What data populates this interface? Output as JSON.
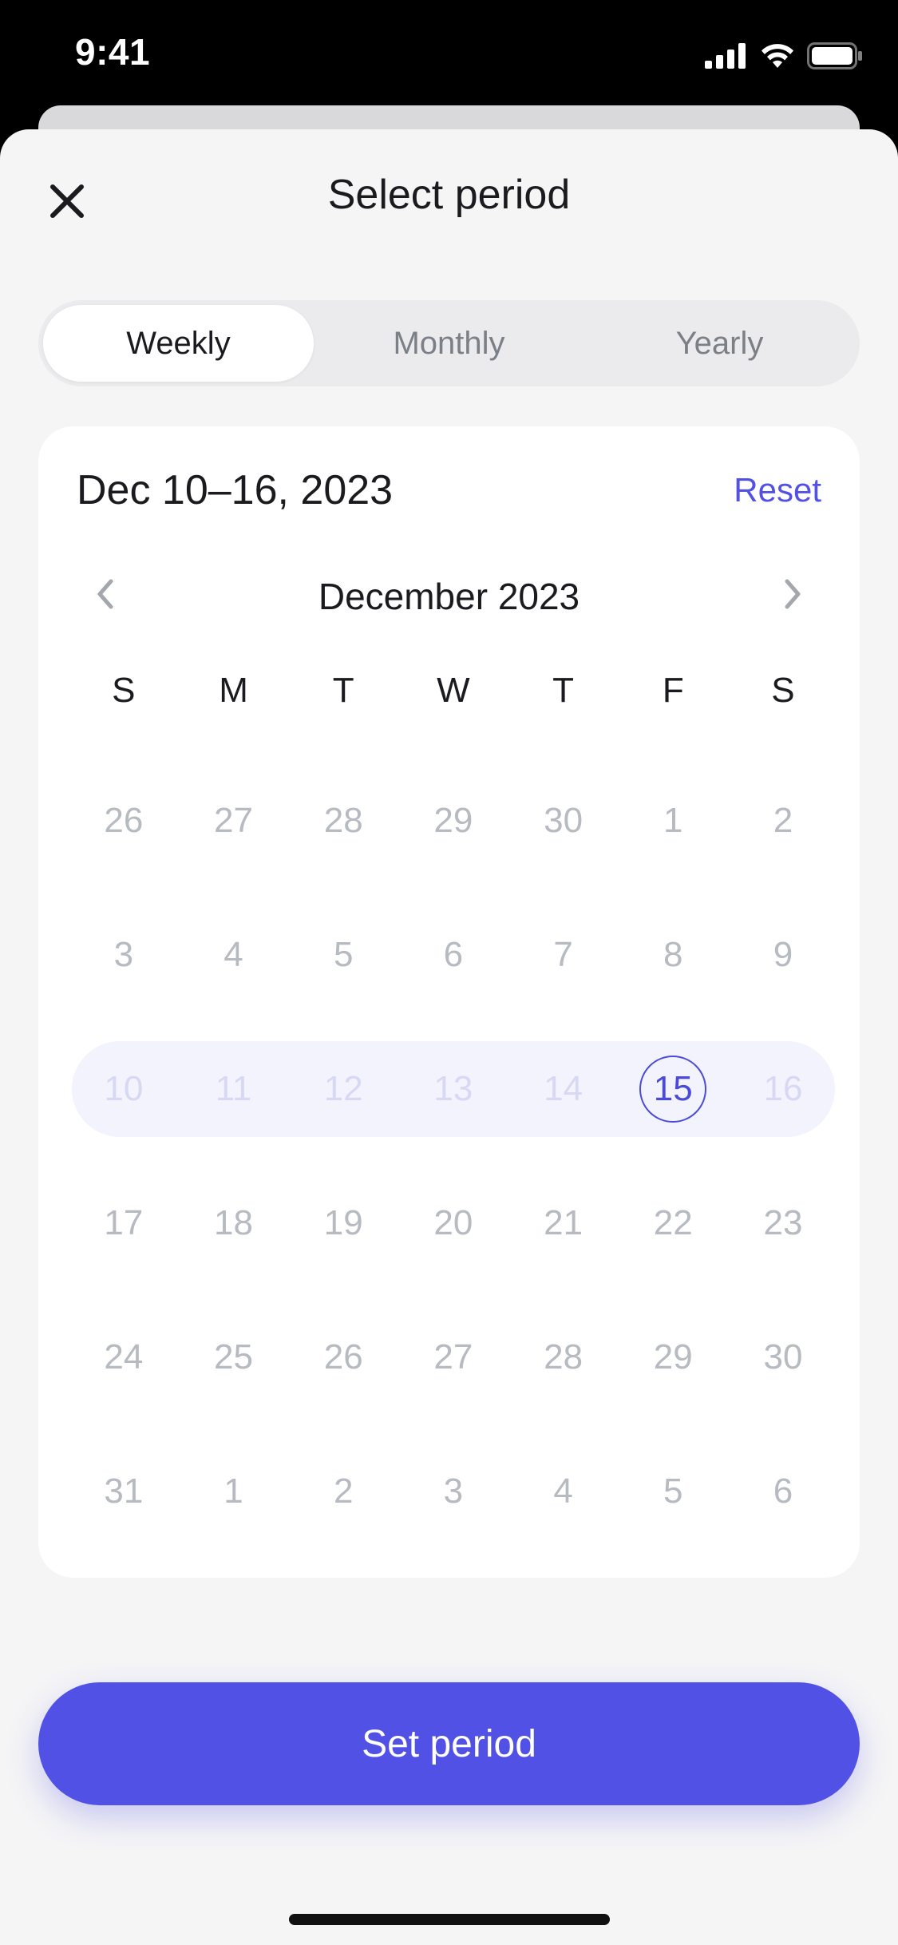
{
  "status_bar": {
    "time": "9:41",
    "icons": [
      "cellular-signal-icon",
      "wifi-icon",
      "battery-icon"
    ]
  },
  "header": {
    "title": "Select period",
    "close_icon": "close-icon"
  },
  "segments": [
    {
      "label": "Weekly",
      "active": true
    },
    {
      "label": "Monthly",
      "active": false
    },
    {
      "label": "Yearly",
      "active": false
    }
  ],
  "calendar": {
    "range_text": "Dec 10–16, 2023",
    "reset_label": "Reset",
    "month_label": "December 2023",
    "weekdays": [
      "S",
      "M",
      "T",
      "W",
      "T",
      "F",
      "S"
    ],
    "weeks": [
      [
        "26",
        "27",
        "28",
        "29",
        "30",
        "1",
        "2"
      ],
      [
        "3",
        "4",
        "5",
        "6",
        "7",
        "8",
        "9"
      ],
      [
        "10",
        "11",
        "12",
        "13",
        "14",
        "15",
        "16"
      ],
      [
        "17",
        "18",
        "19",
        "20",
        "21",
        "22",
        "23"
      ],
      [
        "24",
        "25",
        "26",
        "27",
        "28",
        "29",
        "30"
      ],
      [
        "31",
        "1",
        "2",
        "3",
        "4",
        "5",
        "6"
      ]
    ],
    "selected_week_index": 2,
    "today_label": "15"
  },
  "cta": {
    "label": "Set period"
  },
  "colors": {
    "accent": "#5151e6",
    "today_ring": "#4b4bd8",
    "selected_week_bg": "#f3f3fd",
    "muted_day": "#b6bac1",
    "sheet_bg": "#f5f5f6"
  }
}
